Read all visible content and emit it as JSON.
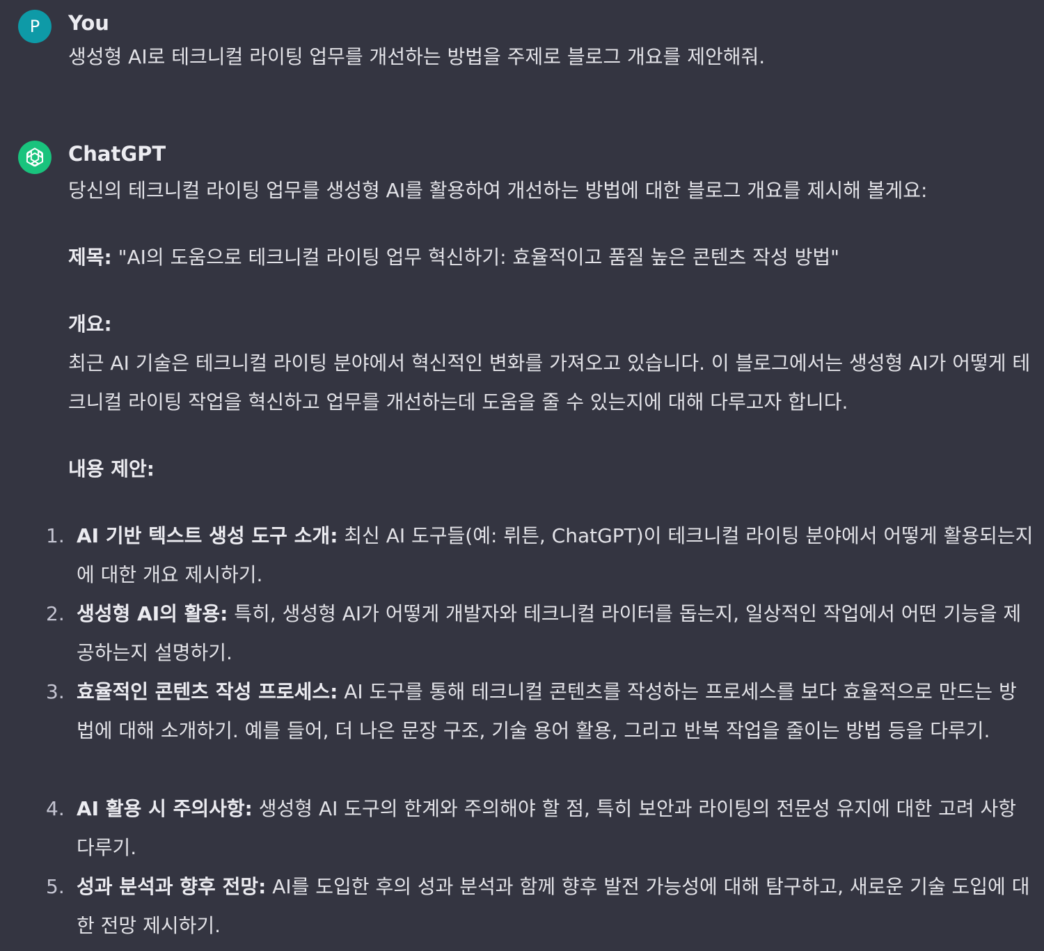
{
  "user_message": {
    "avatar_letter": "P",
    "name": "You",
    "text": "생성형 AI로 테크니컬 라이팅 업무를 개선하는 방법을 주제로 블로그 개요를 제안해줘."
  },
  "assistant_message": {
    "name": "ChatGPT",
    "avatar_icon": "openai-logo-icon",
    "intro": "당신의 테크니컬 라이팅 업무를 생성형 AI를 활용하여 개선하는 방법에 대한 블로그 개요를 제시해 볼게요:",
    "title_label": "제목:",
    "title_text": " \"AI의 도움으로 테크니컬 라이팅 업무 혁신하기: 효율적이고 품질 높은 콘텐츠 작성 방법\"",
    "overview_label": "개요:",
    "overview_text": "최근 AI 기술은 테크니컬 라이팅 분야에서 혁신적인 변화를 가져오고 있습니다. 이 블로그에서는 생성형 AI가 어떻게 테크니컬 라이팅 작업을 혁신하고 업무를 개선하는데 도움을 줄 수 있는지에 대해 다루고자 합니다.",
    "content_label": "내용 제안:",
    "items": [
      {
        "number": "1.",
        "label": "AI 기반 텍스트 생성 도구 소개:",
        "text": " 최신 AI 도구들(예: 뤼튼, ChatGPT)이 테크니컬 라이팅 분야에서 어떻게 활용되는지에 대한 개요 제시하기."
      },
      {
        "number": "2.",
        "label": "생성형 AI의 활용:",
        "text": " 특히, 생성형 AI가 어떻게 개발자와 테크니컬 라이터를 돕는지, 일상적인 작업에서 어떤 기능을 제공하는지 설명하기."
      },
      {
        "number": "3.",
        "label": "효율적인 콘텐츠 작성 프로세스:",
        "text": " AI 도구를 통해 테크니컬 콘텐츠를 작성하는 프로세스를 보다 효율적으로 만드는 방법에 대해 소개하기. 예를 들어, 더 나은 문장 구조, 기술 용어 활용, 그리고 반복 작업을 줄이는 방법 등을 다루기."
      },
      {
        "number": "4.",
        "label": "AI 활용 시 주의사항:",
        "text": " 생성형 AI 도구의 한계와 주의해야 할 점, 특히 보안과 라이팅의 전문성 유지에 대한 고려 사항 다루기."
      },
      {
        "number": "5.",
        "label": "성과 분석과 향후 전망:",
        "text": " AI를 도입한 후의 성과 분석과 함께 향후 발전 가능성에 대해 탐구하고, 새로운 기술 도입에 대한 전망 제시하기."
      }
    ]
  }
}
